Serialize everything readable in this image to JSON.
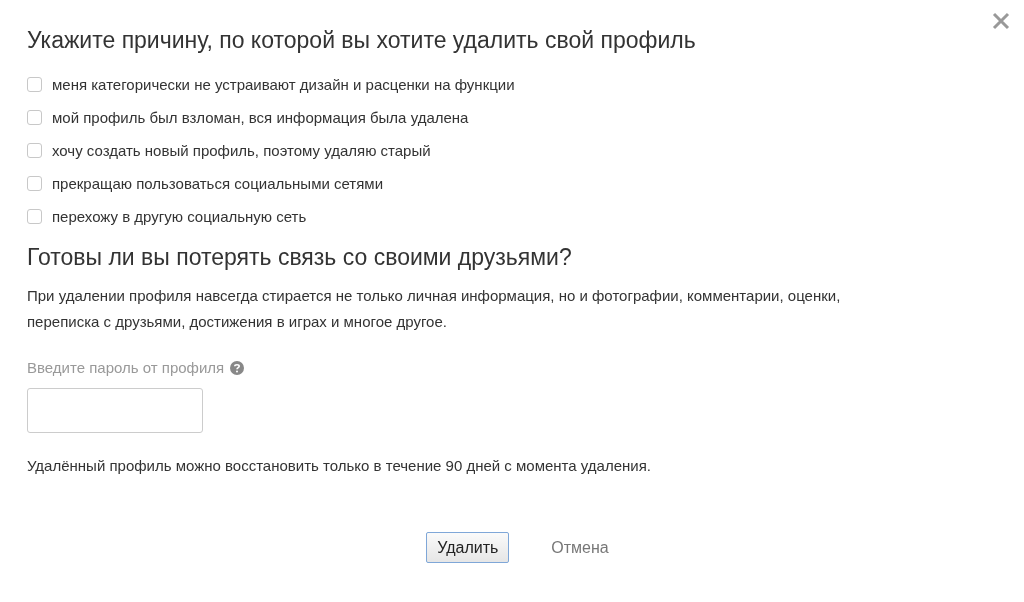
{
  "title": "Укажите причину, по которой вы хотите удалить свой профиль",
  "reasons": [
    {
      "label": "меня категорически не устраивают дизайн и расценки на функции",
      "checked": false
    },
    {
      "label": "мой профиль был взломан, вся информация была удалена",
      "checked": false
    },
    {
      "label": "хочу создать новый профиль, поэтому удаляю старый",
      "checked": false
    },
    {
      "label": "прекращаю пользоваться социальными сетями",
      "checked": false
    },
    {
      "label": "перехожу в другую социальную сеть",
      "checked": false
    }
  ],
  "warning_title": "Готовы ли вы потерять связь со своими друзьями?",
  "warning_text": "При удалении профиля навсегда стирается не только личная информация, но и фотографии, комментарии, оценки, переписка с друзьями, достижения в играх и многое другое.",
  "password": {
    "label": "Введите пароль от профиля"
  },
  "note": "Удалённый профиль можно восстановить только в течение 90 дней с момента удаления.",
  "buttons": {
    "delete": "Удалить",
    "cancel": "Отмена"
  }
}
